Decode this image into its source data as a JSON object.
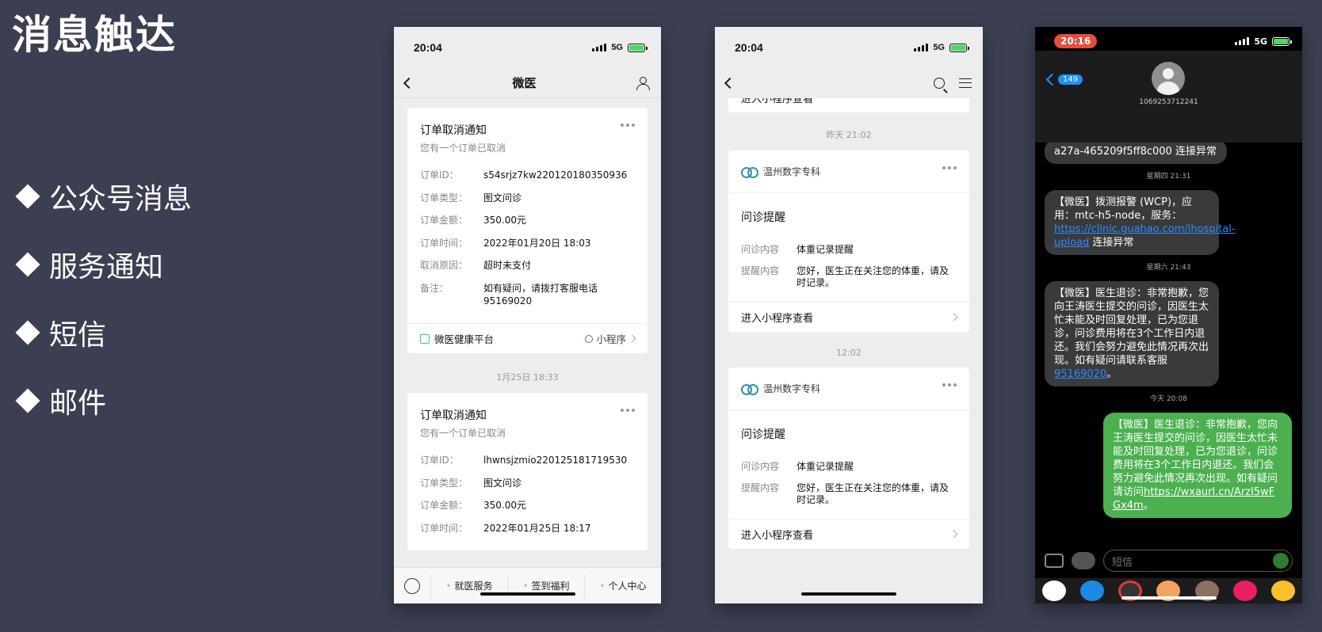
{
  "slide": {
    "title": "消息触达",
    "bullets": [
      "公众号消息",
      "服务通知",
      "短信",
      "邮件"
    ]
  },
  "status": {
    "time": "20:04",
    "network": "5G"
  },
  "phone1": {
    "nav_title": "微医",
    "cards": [
      {
        "title": "订单取消通知",
        "subtitle": "您有一个订单已取消",
        "rows": [
          {
            "k": "订单ID：",
            "v": "s54srjz7kw220120180350936"
          },
          {
            "k": "订单类型：",
            "v": "图文问诊"
          },
          {
            "k": "订单金额：",
            "v": "350.00元"
          },
          {
            "k": "订单时间：",
            "v": "2022年01月20日 18:03"
          },
          {
            "k": "取消原因：",
            "v": "超时未支付"
          },
          {
            "k": "备注：",
            "v": "如有疑问，请拨打客服电话95169020"
          }
        ],
        "footer_left": "微医健康平台",
        "footer_right": "小程序"
      },
      {
        "title": "订单取消通知",
        "subtitle": "您有一个订单已取消",
        "rows": [
          {
            "k": "订单ID：",
            "v": "lhwnsjzmio220125181719530"
          },
          {
            "k": "订单类型：",
            "v": "图文问诊"
          },
          {
            "k": "订单金额：",
            "v": "350.00元"
          },
          {
            "k": "订单时间：",
            "v": "2022年01月25日 18:17"
          }
        ]
      }
    ],
    "separator": "1月25日 18:33",
    "tabs": [
      "就医服务",
      "签到福利",
      "个人中心"
    ]
  },
  "phone2": {
    "partial_text": "进入小程序查看",
    "separators": [
      "昨天 21:02",
      "12:02"
    ],
    "card": {
      "brand": "温州数字专科",
      "title": "问诊提醒",
      "rows": [
        {
          "k": "问诊内容",
          "v": "体重记录提醒"
        },
        {
          "k": "提醒内容",
          "v": "您好，医生正在关注您的体重，请及时记录。"
        }
      ],
      "footer": "进入小程序查看"
    }
  },
  "phone3": {
    "time": "20:16",
    "back_badge": "149",
    "contact": "1069253712241",
    "msg0": "a27a-465209f5ff8c000 连接异常",
    "ts1": "星期四 21:31",
    "msg1_text": "【微医】拨测报警 (WCP)，应用：mtc-h5-node，服务：",
    "msg1_link": "https://clinic.guahao.com/ihospital-upload",
    "msg1_tail": " 连接异常",
    "ts2": "星期六 21:43",
    "msg2_text": "【微医】医生退诊：非常抱歉，您向王涛医生提交的问诊，因医生太忙未能及时回复处理，已为您退诊，问诊费用将在3个工作日内退还。我们会努力避免此情况再次出现。如有疑问请联系客服",
    "msg2_link": "95169020",
    "msg2_tail": "。",
    "ts3": "今天 20:08",
    "msg3_text": "【微医】医生退诊：非常抱歉，您向王涛医生提交的问诊，因医生太忙未能及时回复处理，已为您退诊，问诊费用将在3个工作日内退还。我们会努力避免此情况再次出现。如有疑问请访问",
    "msg3_link": "https://wxaurl.cn/ArzI5wFGx4m",
    "msg3_tail": "。",
    "input_placeholder": "短信"
  }
}
